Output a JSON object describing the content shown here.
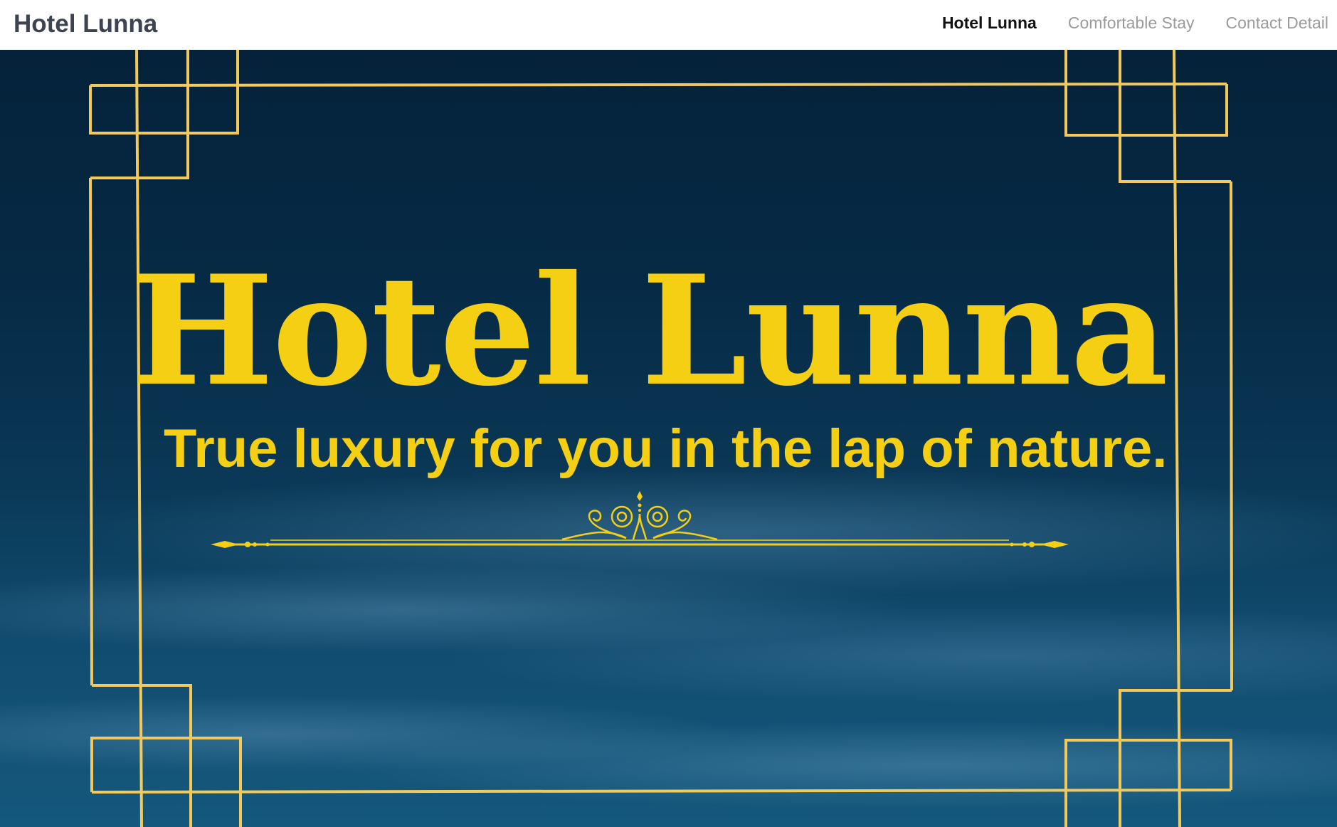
{
  "navbar": {
    "brand": "Hotel Lunna",
    "links": [
      {
        "label": "Hotel Lunna",
        "active": true
      },
      {
        "label": "Comfortable Stay",
        "active": false
      },
      {
        "label": "Contact Detail",
        "active": false
      }
    ]
  },
  "hero": {
    "title": "Hotel Lunna",
    "tagline": "True luxury for you in the lap of nature."
  },
  "colors": {
    "accent": "#f5cf14",
    "frame": "#f2c95a",
    "brand_text": "#3d4350",
    "nav_inactive": "#9b9b9b",
    "nav_active": "#111111",
    "background": "#062a45"
  },
  "icons": [
    "ornamental-divider-icon"
  ]
}
